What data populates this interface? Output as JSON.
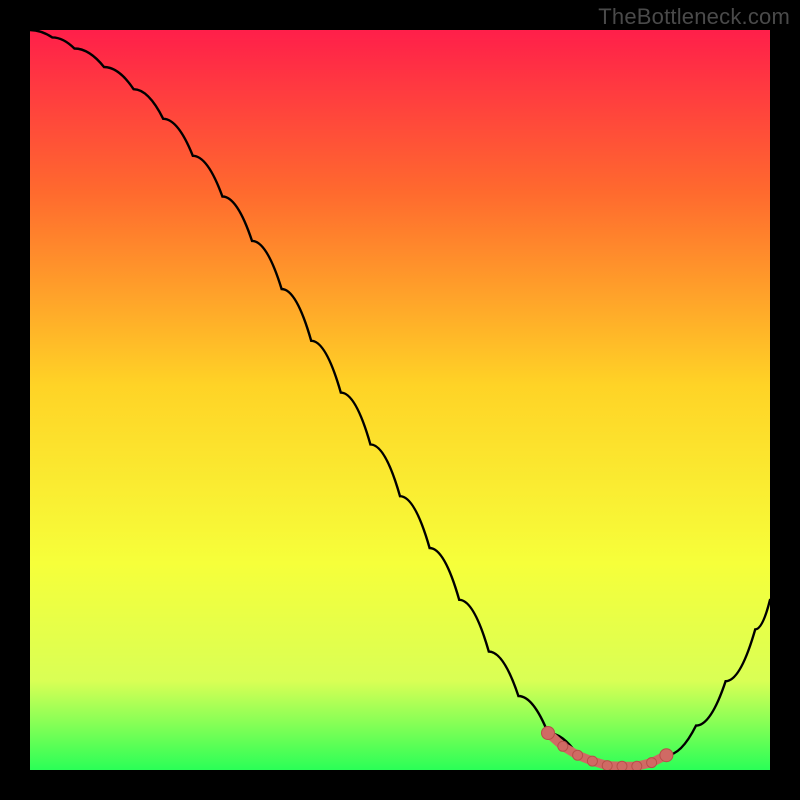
{
  "watermark": "TheBottleneck.com",
  "colors": {
    "background": "#000000",
    "gradient_top": "#ff1f4a",
    "gradient_mid_upper": "#ff6a2e",
    "gradient_mid": "#ffd326",
    "gradient_mid_lower": "#f6ff3a",
    "gradient_lower": "#d9ff55",
    "gradient_bottom": "#2aff57",
    "curve": "#000000",
    "marker_fill": "#d06a64",
    "marker_stroke": "#b84f4a"
  },
  "chart_data": {
    "type": "line",
    "title": "",
    "xlabel": "",
    "ylabel": "",
    "xlim": [
      0,
      100
    ],
    "ylim": [
      0,
      100
    ],
    "series": [
      {
        "name": "bottleneck-curve",
        "x": [
          0,
          3,
          6,
          10,
          14,
          18,
          22,
          26,
          30,
          34,
          38,
          42,
          46,
          50,
          54,
          58,
          62,
          66,
          70,
          74,
          78,
          82,
          86,
          90,
          94,
          98,
          100
        ],
        "y": [
          100,
          99,
          97.5,
          95,
          92,
          88,
          83,
          77.5,
          71.5,
          65,
          58,
          51,
          44,
          37,
          30,
          23,
          16,
          10,
          5,
          2,
          0.5,
          0.5,
          2,
          6,
          12,
          19,
          23
        ]
      }
    ],
    "markers": {
      "name": "optimal-range",
      "x": [
        70,
        72,
        74,
        76,
        78,
        80,
        82,
        84,
        86
      ],
      "y": [
        5,
        3.2,
        2,
        1.2,
        0.6,
        0.5,
        0.5,
        1,
        2
      ]
    }
  }
}
